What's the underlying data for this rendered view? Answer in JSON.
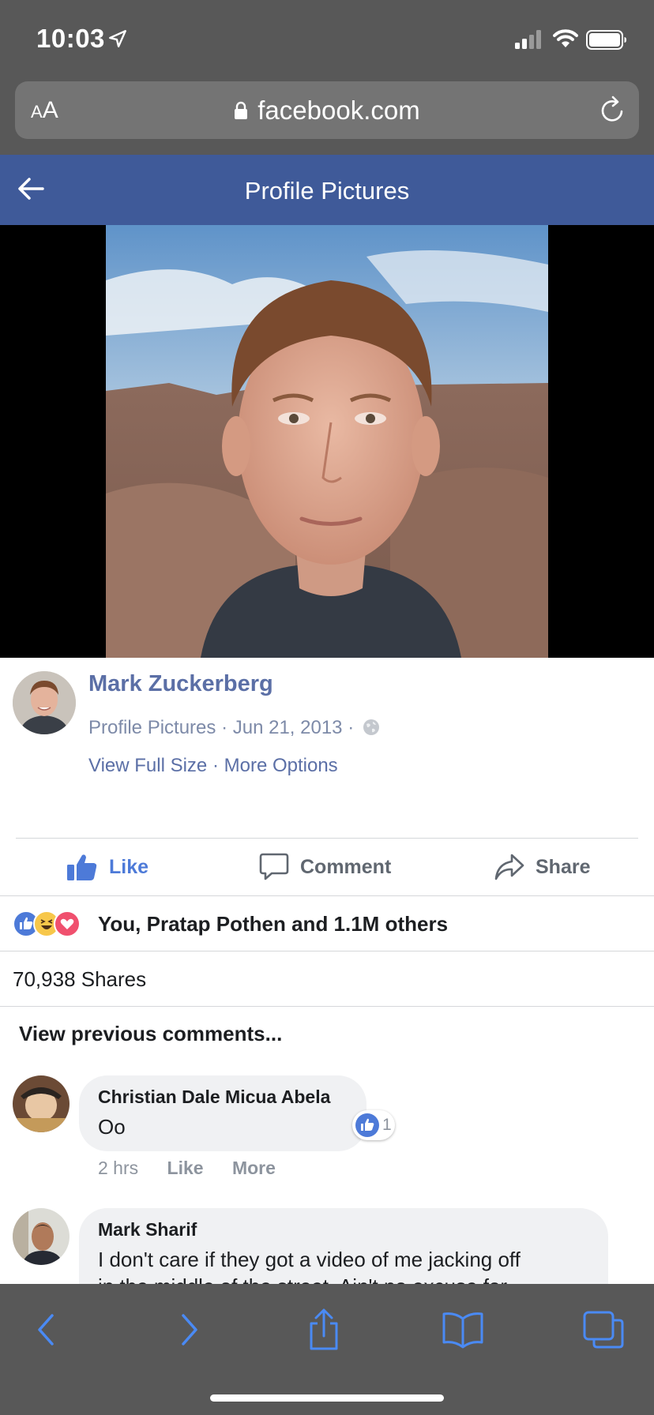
{
  "status_bar": {
    "time": "10:03"
  },
  "browser": {
    "text_size_label": "AA",
    "url": "facebook.com"
  },
  "header": {
    "title": "Profile Pictures"
  },
  "post": {
    "author": "Mark Zuckerberg",
    "album": "Profile Pictures",
    "date": "Jun 21, 2013",
    "separator": "·",
    "view_full_size": "View Full Size",
    "more_options": "More Options"
  },
  "actions": {
    "like": "Like",
    "comment": "Comment",
    "share": "Share"
  },
  "reactions": {
    "summary": "You, Pratap Pothen and 1.1M others",
    "types": [
      "like",
      "haha",
      "love"
    ]
  },
  "shares": "70,938 Shares",
  "view_previous_comments": "View previous comments...",
  "comments": [
    {
      "name": "Christian Dale Micua Abela",
      "text": "Oo",
      "time": "2 hrs",
      "like_label": "Like",
      "more_label": "More",
      "like_count": "1"
    },
    {
      "name": "Mark Sharif",
      "text": "I don't care if they got a video of me jacking off",
      "text_line2": "in the middle of the street. Ain't no excuse for"
    }
  ],
  "colors": {
    "facebook_blue": "#3f5a99",
    "link_blue": "#5b6fa6",
    "like_blue": "#4d7ad8",
    "safari_chrome": "#585858",
    "ios_blue": "#4a8af4"
  },
  "toolbar_icons": [
    "back-icon",
    "forward-icon",
    "share-icon",
    "bookmarks-icon",
    "tabs-icon"
  ]
}
